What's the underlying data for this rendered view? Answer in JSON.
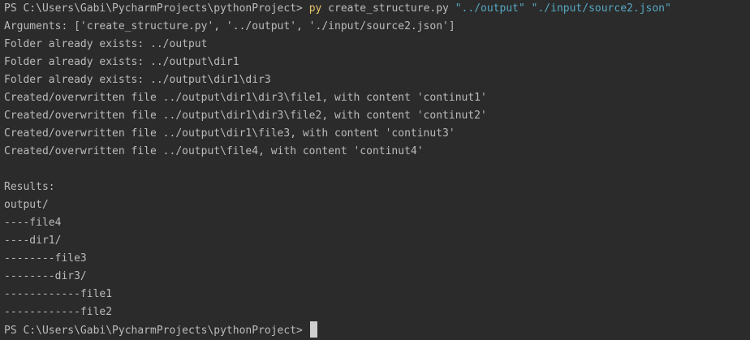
{
  "terminal": {
    "prompt": "PS C:\\Users\\Gabi\\PycharmProjects\\pythonProject> ",
    "command": {
      "program": "py",
      "script": "create_structure.py",
      "arg1": "\"../output\"",
      "arg2": "\"./input/source2.json\""
    },
    "output_lines": [
      "Arguments: ['create_structure.py', '../output', './input/source2.json']",
      "Folder already exists: ../output",
      "Folder already exists: ../output\\dir1",
      "Folder already exists: ../output\\dir1\\dir3",
      "Created/overwritten file ../output\\dir1\\dir3\\file1, with content 'continut1'",
      "Created/overwritten file ../output\\dir1\\dir3\\file2, with content 'continut2'",
      "Created/overwritten file ../output\\dir1\\file3, with content 'continut3'",
      "Created/overwritten file ../output\\file4, with content 'continut4'",
      "",
      "Results:",
      "output/",
      "----file4",
      "----dir1/",
      "--------file3",
      "--------dir3/",
      "------------file1",
      "------------file2"
    ],
    "final_prompt": "PS C:\\Users\\Gabi\\PycharmProjects\\pythonProject> ",
    "colors": {
      "background": "#2b2b2b",
      "text": "#bbbbbb",
      "command": "#e8c46b",
      "argument": "#56a8c2",
      "cursor": "#cfcfcf"
    }
  }
}
